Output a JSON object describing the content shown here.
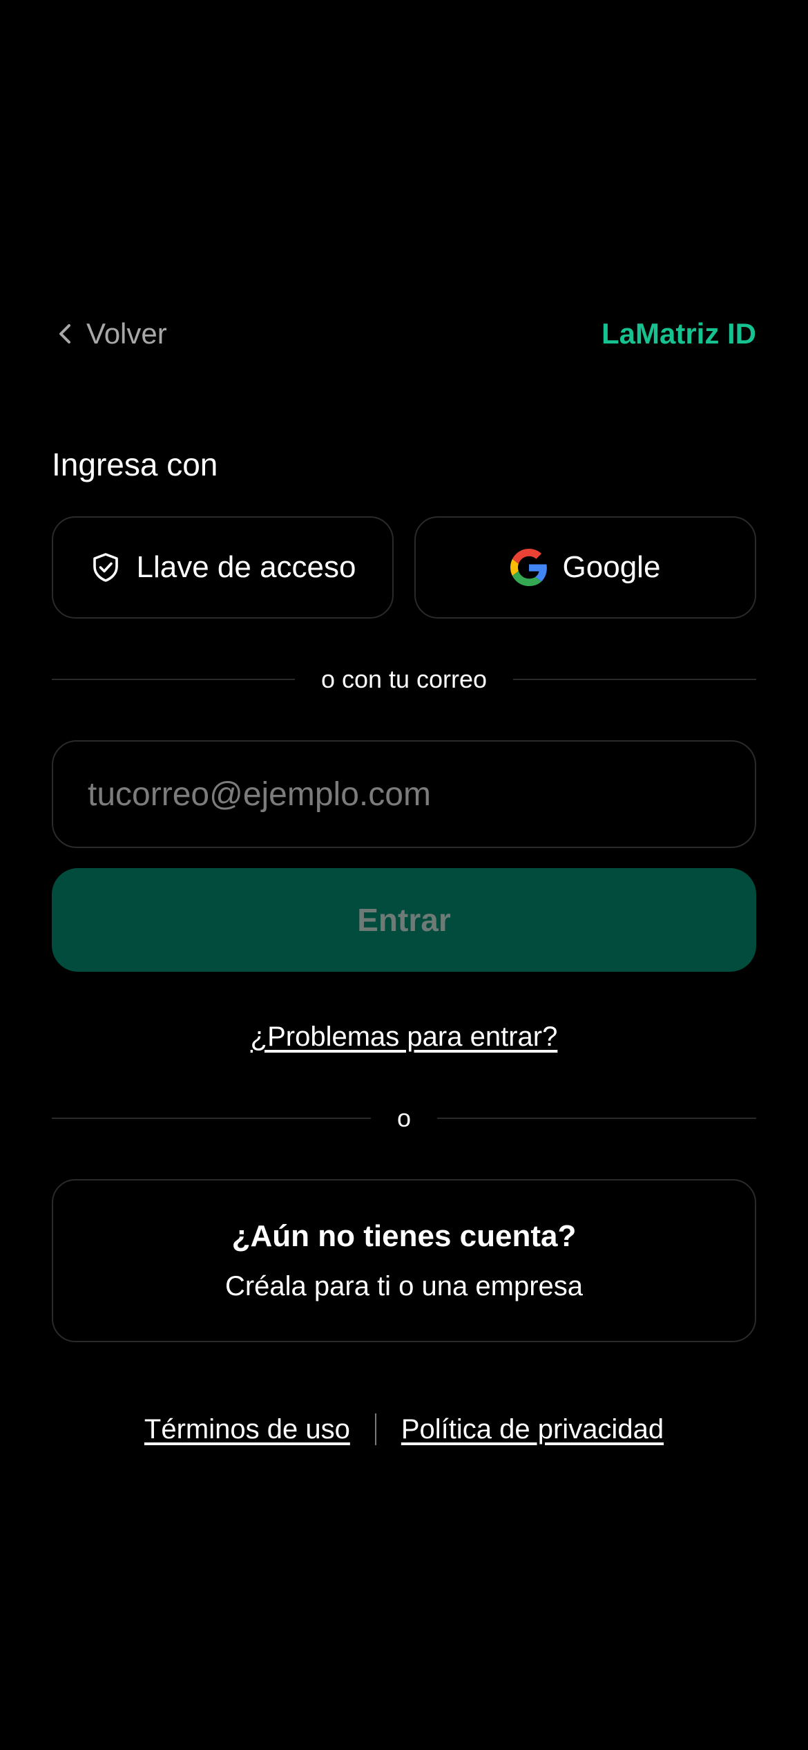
{
  "header": {
    "back_label": "Volver",
    "brand": "LaMatriz ID"
  },
  "login": {
    "section_title": "Ingresa con",
    "providers": [
      {
        "label": "Llave de acceso",
        "icon": "shield-check-icon"
      },
      {
        "label": "Google",
        "icon": "google-icon"
      }
    ],
    "email_divider": "o con tu correo",
    "email_placeholder": "tucorreo@ejemplo.com",
    "email_value": "",
    "submit_label": "Entrar",
    "help_link": "¿Problemas para entrar?"
  },
  "or_divider": "o",
  "signup": {
    "title": "¿Aún no tienes cuenta?",
    "subtitle": "Créala para ti o una empresa"
  },
  "footer": {
    "terms": "Términos de uso",
    "privacy": "Política de privacidad"
  },
  "colors": {
    "background": "#000000",
    "brand_accent": "#16c28f",
    "submit_bg_disabled": "#014c3d",
    "border": "#2a2a2a"
  }
}
